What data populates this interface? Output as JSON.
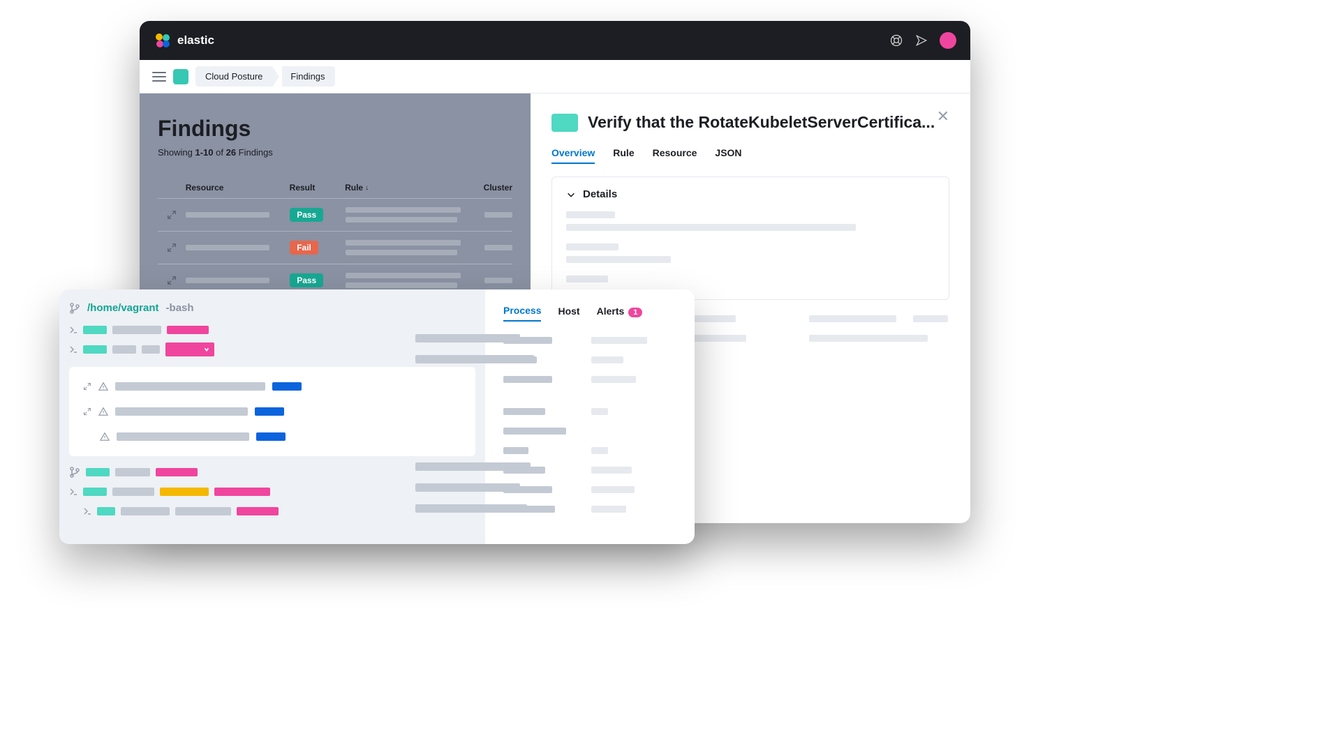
{
  "brand": "elastic",
  "breadcrumb": {
    "item1": "Cloud Posture",
    "item2": "Findings"
  },
  "findings": {
    "title": "Findings",
    "subtitle_prefix": "Showing ",
    "range": "1-10",
    "subtitle_mid": " of ",
    "total": "26",
    "subtitle_suffix": " Findings",
    "columns": {
      "resource": "Resource",
      "result": "Result",
      "rule": "Rule",
      "cluster": "Cluster"
    },
    "rows": [
      {
        "result": "Pass"
      },
      {
        "result": "Fail"
      },
      {
        "result": "Pass"
      }
    ]
  },
  "detail": {
    "title": "Verify that the RotateKubeletServerCertifica...",
    "tabs": {
      "overview": "Overview",
      "rule": "Rule",
      "resource": "Resource",
      "json": "JSON"
    },
    "section": "Details"
  },
  "terminal": {
    "path": "/home/vagrant",
    "shell": "-bash"
  },
  "process": {
    "tabs": {
      "process": "Process",
      "host": "Host",
      "alerts": "Alerts"
    },
    "alerts_count": "1"
  }
}
